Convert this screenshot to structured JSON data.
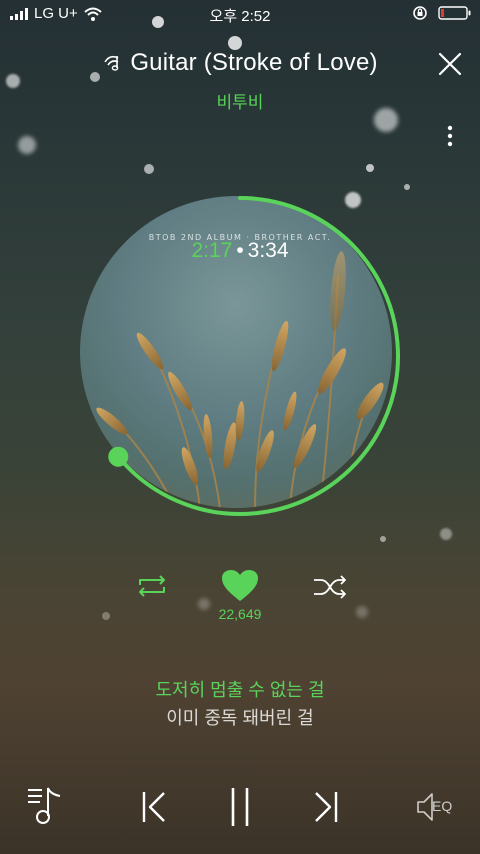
{
  "status_bar": {
    "carrier": "LG U+",
    "time": "오후 2:52"
  },
  "header": {
    "song_title": "Guitar (Stroke of Love)",
    "artist": "비투비"
  },
  "album": {
    "label": "BTOB 2ND ALBUM · BROTHER ACT.",
    "elapsed": "2:17",
    "separator": "•",
    "total": "3:34",
    "progress": 0.64
  },
  "actions": {
    "like_count": "22,649"
  },
  "lyrics": {
    "current": "도저히 멈출 수 없는 걸",
    "next": "이미 중독 돼버린 걸"
  },
  "controls": {
    "eq_label": "EQ"
  },
  "colors": {
    "accent": "#5ad35a",
    "battery_low": "#e53935"
  }
}
